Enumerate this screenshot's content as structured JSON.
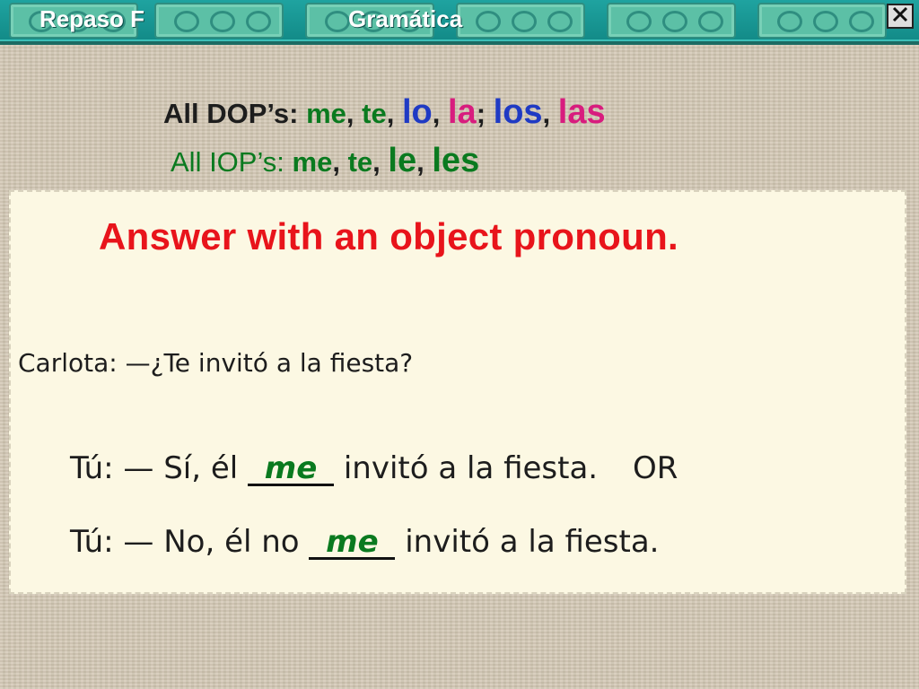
{
  "header": {
    "left_title": "Repaso F",
    "right_title": "Gramática",
    "close_icon": "close-x-icon"
  },
  "dop_line": {
    "label": "All DOP’s:",
    "pronouns": [
      "me",
      "te",
      "lo",
      "la",
      "los",
      "las"
    ]
  },
  "iop_line": {
    "label": "All IOP’s:",
    "pronouns": [
      "me",
      "te",
      "le",
      "les"
    ]
  },
  "panel": {
    "heading": "Answer with an object pronoun.",
    "question": "Carlota: —¿Te invitó a la fiesta?",
    "answer1": {
      "prefix": "Tú: — Sí, él",
      "blank": "me",
      "suffix": "invitó a la fiesta.",
      "connector": "OR"
    },
    "answer2": {
      "prefix": "Tú: — No, él no",
      "blank": "me",
      "suffix": "invitó a la fiesta."
    }
  },
  "colors": {
    "banner": "#1fa3a0",
    "heading": "#e8141b",
    "green_pronoun": "#0a7a1f",
    "blue_pronoun": "#1f3ac4",
    "pink_pronoun": "#d81c7e",
    "panel_bg": "#fcf8e3"
  }
}
